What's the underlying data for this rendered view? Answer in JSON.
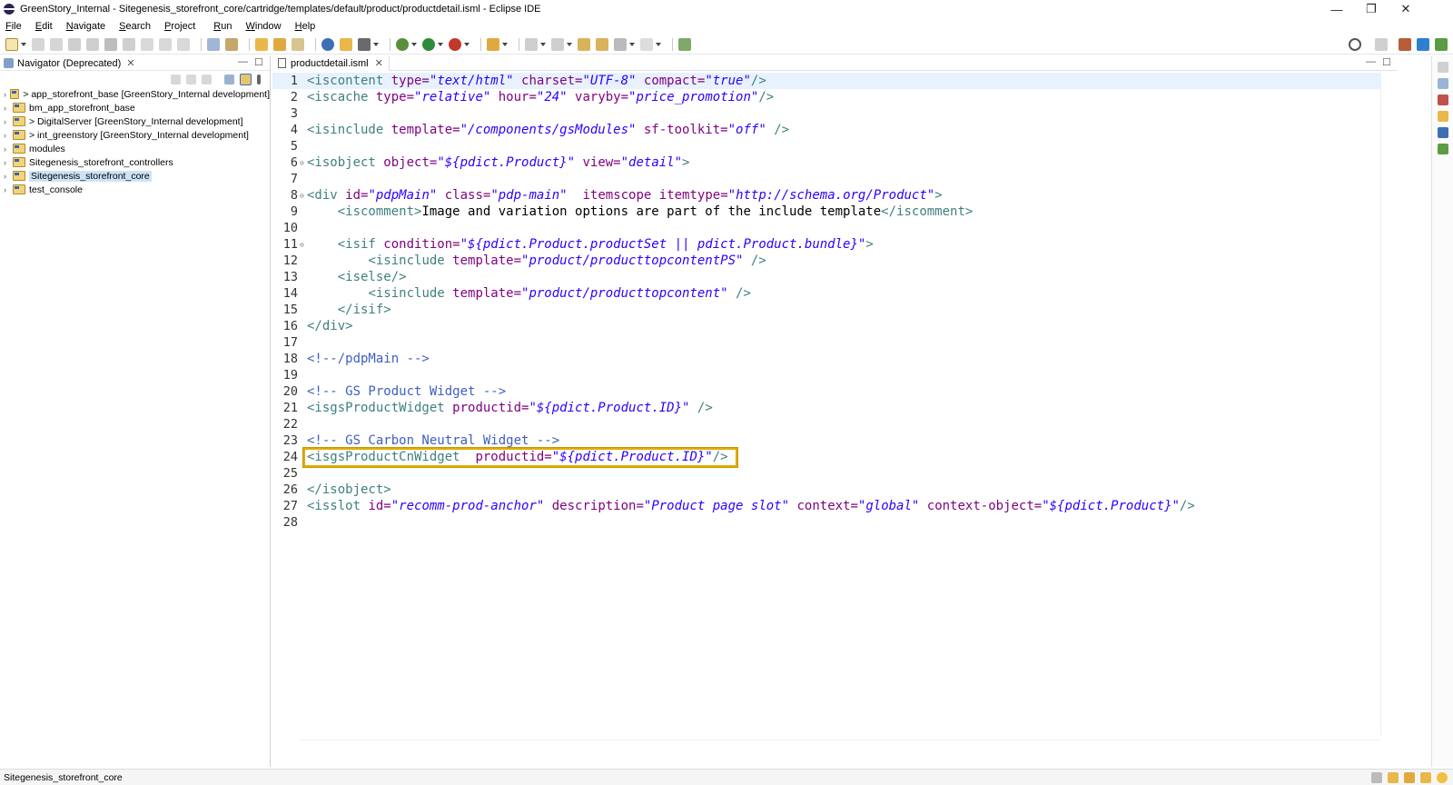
{
  "window": {
    "title": "GreenStory_Internal - Sitegenesis_storefront_core/cartridge/templates/default/product/productdetail.isml - Eclipse IDE",
    "controls": {
      "minimize": "—",
      "restore": "❐",
      "close": "✕"
    }
  },
  "menu": [
    "File",
    "Edit",
    "Navigate",
    "Search",
    "Project",
    "Run",
    "Window",
    "Help"
  ],
  "navigator": {
    "title": "Navigator (Deprecated)",
    "close": "✕",
    "items": [
      {
        "label": "> app_storefront_base [GreenStory_Internal development]",
        "selected": false
      },
      {
        "label": "bm_app_storefront_base",
        "selected": false
      },
      {
        "label": "> DigitalServer [GreenStory_Internal development]",
        "selected": false
      },
      {
        "label": "> int_greenstory [GreenStory_Internal development]",
        "selected": false
      },
      {
        "label": "modules",
        "selected": false
      },
      {
        "label": "Sitegenesis_storefront_controllers",
        "selected": false
      },
      {
        "label": "Sitegenesis_storefront_core",
        "selected": true
      },
      {
        "label": "test_console",
        "selected": false
      }
    ],
    "arrow": "›"
  },
  "editor": {
    "tab_label": "productdetail.isml",
    "tab_close": "✕",
    "highlight_line": 24,
    "lines": [
      {
        "n": "1",
        "fold": "",
        "tokens": [
          [
            "tag",
            "<iscontent "
          ],
          [
            "attr",
            "type="
          ],
          [
            "val",
            "\"text/html\""
          ],
          [
            "attr",
            " charset="
          ],
          [
            "val",
            "\"UTF-8\""
          ],
          [
            "attr",
            " compact="
          ],
          [
            "val",
            "\"true\""
          ],
          [
            "tag",
            "/>"
          ]
        ]
      },
      {
        "n": "2",
        "fold": "",
        "tokens": [
          [
            "tag",
            "<iscache "
          ],
          [
            "attr",
            "type="
          ],
          [
            "val",
            "\"relative\""
          ],
          [
            "attr",
            " hour="
          ],
          [
            "val",
            "\"24\""
          ],
          [
            "attr",
            " varyby="
          ],
          [
            "val",
            "\"price_promotion\""
          ],
          [
            "tag",
            "/>"
          ]
        ]
      },
      {
        "n": "3",
        "fold": "",
        "tokens": []
      },
      {
        "n": "4",
        "fold": "",
        "tokens": [
          [
            "tag",
            "<isinclude "
          ],
          [
            "attr",
            "template="
          ],
          [
            "val",
            "\"/components/gsModules\""
          ],
          [
            "attr",
            " sf-toolkit="
          ],
          [
            "val",
            "\"off\""
          ],
          [
            "tag",
            " />"
          ]
        ]
      },
      {
        "n": "5",
        "fold": "",
        "tokens": []
      },
      {
        "n": "6",
        "fold": "⊖",
        "tokens": [
          [
            "tag",
            "<isobject "
          ],
          [
            "attr",
            "object="
          ],
          [
            "val",
            "\"${pdict.Product}\""
          ],
          [
            "attr",
            " view="
          ],
          [
            "val",
            "\"detail\""
          ],
          [
            "tag",
            ">"
          ]
        ]
      },
      {
        "n": "7",
        "fold": "",
        "tokens": []
      },
      {
        "n": "8",
        "fold": "⊖",
        "tokens": [
          [
            "tag",
            "<div "
          ],
          [
            "attr",
            "id="
          ],
          [
            "val",
            "\"pdpMain\""
          ],
          [
            "attr",
            " class="
          ],
          [
            "val",
            "\"pdp-main\""
          ],
          [
            "attr",
            "  itemscope itemtype="
          ],
          [
            "val",
            "\"http://schema.org/Product\""
          ],
          [
            "tag",
            ">"
          ]
        ]
      },
      {
        "n": "9",
        "fold": "",
        "tokens": [
          [
            "text",
            "    "
          ],
          [
            "tag",
            "<iscomment>"
          ],
          [
            "text",
            "Image and variation options are part of the include template"
          ],
          [
            "tag",
            "</iscomment>"
          ]
        ]
      },
      {
        "n": "10",
        "fold": "",
        "tokens": []
      },
      {
        "n": "11",
        "fold": "⊖",
        "tokens": [
          [
            "text",
            "    "
          ],
          [
            "tag",
            "<isif "
          ],
          [
            "attr",
            "condition="
          ],
          [
            "val",
            "\"${pdict.Product.productSet || pdict.Product.bundle}\""
          ],
          [
            "tag",
            ">"
          ]
        ]
      },
      {
        "n": "12",
        "fold": "",
        "tokens": [
          [
            "text",
            "        "
          ],
          [
            "tag",
            "<isinclude "
          ],
          [
            "attr",
            "template="
          ],
          [
            "val",
            "\"product/producttopcontentPS\""
          ],
          [
            "tag",
            " />"
          ]
        ]
      },
      {
        "n": "13",
        "fold": "",
        "tokens": [
          [
            "text",
            "    "
          ],
          [
            "tag",
            "<iselse/>"
          ]
        ]
      },
      {
        "n": "14",
        "fold": "",
        "tokens": [
          [
            "text",
            "        "
          ],
          [
            "tag",
            "<isinclude "
          ],
          [
            "attr",
            "template="
          ],
          [
            "val",
            "\"product/producttopcontent\""
          ],
          [
            "tag",
            " />"
          ]
        ]
      },
      {
        "n": "15",
        "fold": "",
        "tokens": [
          [
            "text",
            "    "
          ],
          [
            "tag",
            "</isif>"
          ]
        ]
      },
      {
        "n": "16",
        "fold": "",
        "tokens": [
          [
            "tag",
            "</div>"
          ]
        ]
      },
      {
        "n": "17",
        "fold": "",
        "tokens": []
      },
      {
        "n": "18",
        "fold": "",
        "tokens": [
          [
            "com",
            "<!--/pdpMain -->"
          ]
        ]
      },
      {
        "n": "19",
        "fold": "",
        "tokens": []
      },
      {
        "n": "20",
        "fold": "",
        "tokens": [
          [
            "com",
            "<!-- GS Product Widget -->"
          ]
        ]
      },
      {
        "n": "21",
        "fold": "",
        "tokens": [
          [
            "tag",
            "<isgsProductWidget "
          ],
          [
            "attr",
            "productid="
          ],
          [
            "val",
            "\"${pdict.Product.ID}\""
          ],
          [
            "tag",
            " />"
          ]
        ]
      },
      {
        "n": "22",
        "fold": "",
        "tokens": []
      },
      {
        "n": "23",
        "fold": "",
        "tokens": [
          [
            "com",
            "<!-- GS Carbon Neutral Widget -->"
          ]
        ]
      },
      {
        "n": "24",
        "fold": "",
        "tokens": [
          [
            "tag",
            "<isgsProductCnWidget "
          ],
          [
            "attr",
            " productid="
          ],
          [
            "val",
            "\"${pdict.Product.ID}\""
          ],
          [
            "tag",
            "/>"
          ]
        ]
      },
      {
        "n": "25",
        "fold": "",
        "tokens": []
      },
      {
        "n": "26",
        "fold": "",
        "tokens": [
          [
            "tag",
            "</isobject>"
          ]
        ]
      },
      {
        "n": "27",
        "fold": "",
        "tokens": [
          [
            "tag",
            "<isslot "
          ],
          [
            "attr",
            "id="
          ],
          [
            "val",
            "\"recomm-prod-anchor\""
          ],
          [
            "attr",
            " description="
          ],
          [
            "val",
            "\"Product page slot\""
          ],
          [
            "attr",
            " context="
          ],
          [
            "val",
            "\"global\""
          ],
          [
            "attr",
            " context-object="
          ],
          [
            "val",
            "\"${pdict.Product}\""
          ],
          [
            "tag",
            "/>"
          ]
        ]
      },
      {
        "n": "28",
        "fold": "",
        "tokens": []
      }
    ]
  },
  "status": {
    "text": "Sitegenesis_storefront_core"
  },
  "colors": {
    "tag": "#3f7f7f",
    "attr": "#7f007f",
    "value": "#2a00ff",
    "comment": "#3f5fbf",
    "highlight_border": "#e0ac00",
    "selection": "#cde4f7"
  },
  "icons": {
    "toolbar": [
      "new-icon",
      "save-icon",
      "save-all-icon",
      "run-last-icon",
      "suspend-icon",
      "terminate-icon",
      "disconnect-icon",
      "step-into-icon",
      "step-over-icon",
      "step-return-icon",
      "toggle-word-wrap-icon",
      "open-type-icon",
      "build-icon",
      "external-tools-icon",
      "debug-icon",
      "run-icon",
      "coverage-icon",
      "search-icon",
      "next-annotation-icon",
      "prev-annotation-icon",
      "last-edit-icon",
      "back-icon",
      "forward-icon",
      "pin-editor-icon"
    ],
    "perspectives": [
      "quick-access-search-icon",
      "open-perspective-icon",
      "java-perspective-icon",
      "debug-perspective-icon"
    ]
  }
}
